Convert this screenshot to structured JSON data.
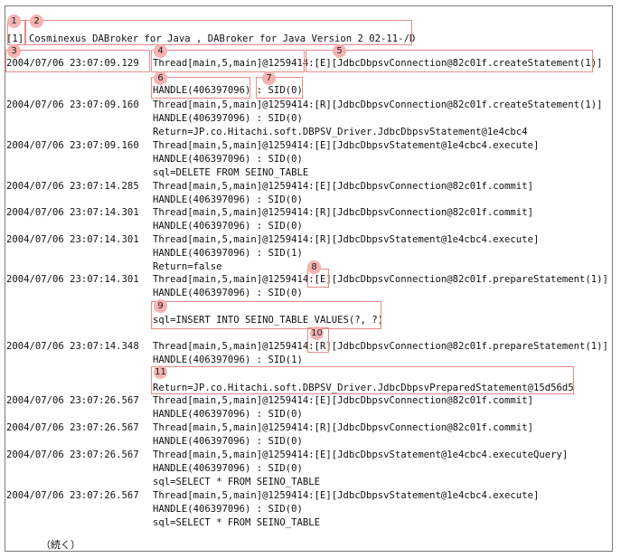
{
  "header": {
    "index": "[1]",
    "title": "Cosminexus DABroker for Java , DABroker for Java Version 2 02-11-/D"
  },
  "badges": [
    "1",
    "2",
    "3",
    "4",
    "5",
    "6",
    "7",
    "8",
    "9",
    "10",
    "11"
  ],
  "entries": [
    {
      "ts": "2004/07/06 23:07:09.129",
      "lines": [
        "Thread[main,5,main]@1259414:[E][JdbcDbpsvConnection@82c01f.createStatement(1)]",
        "HANDLE(406397096) : SID(0)"
      ]
    },
    {
      "ts": "2004/07/06 23:07:09.160",
      "lines": [
        "Thread[main,5,main]@1259414:[R][JdbcDbpsvConnection@82c01f.createStatement(1)]",
        "HANDLE(406397096) : SID(0)",
        "Return=JP.co.Hitachi.soft.DBPSV_Driver.JdbcDbpsvStatement@1e4cbc4"
      ]
    },
    {
      "ts": "2004/07/06 23:07:09.160",
      "lines": [
        "Thread[main,5,main]@1259414:[E][JdbcDbpsvStatement@1e4cbc4.execute]",
        "HANDLE(406397096) : SID(0)",
        "sql=DELETE FROM SEINO_TABLE"
      ]
    },
    {
      "ts": "2004/07/06 23:07:14.285",
      "lines": [
        "Thread[main,5,main]@1259414:[E][JdbcDbpsvConnection@82c01f.commit]",
        "HANDLE(406397096) : SID(0)"
      ]
    },
    {
      "ts": "2004/07/06 23:07:14.301",
      "lines": [
        "Thread[main,5,main]@1259414:[R][JdbcDbpsvConnection@82c01f.commit]",
        "HANDLE(406397096) : SID(0)"
      ]
    },
    {
      "ts": "2004/07/06 23:07:14.301",
      "lines": [
        "Thread[main,5,main]@1259414:[R][JdbcDbpsvStatement@1e4cbc4.execute]",
        "HANDLE(406397096) : SID(1)",
        "Return=false"
      ]
    },
    {
      "ts": "2004/07/06 23:07:14.301",
      "lines": [
        "Thread[main,5,main]@1259414:[E][JdbcDbpsvConnection@82c01f.prepareStatement(1)]",
        "HANDLE(406397096) : SID(0)",
        "sql=INSERT INTO SEINO_TABLE VALUES(?, ?)"
      ]
    },
    {
      "ts": "2004/07/06 23:07:14.348",
      "lines": [
        "Thread[main,5,main]@1259414:[R][JdbcDbpsvConnection@82c01f.prepareStatement(1)]",
        "HANDLE(406397096) : SID(1)",
        "Return=JP.co.Hitachi.soft.DBPSV_Driver.JdbcDbpsvPreparedStatement@15d56d5"
      ]
    },
    {
      "ts": "2004/07/06 23:07:26.567",
      "lines": [
        "Thread[main,5,main]@1259414:[E][JdbcDbpsvConnection@82c01f.commit]",
        "HANDLE(406397096) : SID(0)"
      ]
    },
    {
      "ts": "2004/07/06 23:07:26.567",
      "lines": [
        "Thread[main,5,main]@1259414:[R][JdbcDbpsvConnection@82c01f.commit]",
        "HANDLE(406397096) : SID(0)"
      ]
    },
    {
      "ts": "2004/07/06 23:07:26.567",
      "lines": [
        "Thread[main,5,main]@1259414:[E][JdbcDbpsvStatement@1e4cbc4.executeQuery]",
        "HANDLE(406397096) : SID(0)",
        "sql=SELECT * FROM SEINO_TABLE"
      ]
    },
    {
      "ts": "2004/07/06 23:07:26.567",
      "lines": [
        "Thread[main,5,main]@1259414:[E][JdbcDbpsvStatement@1e4cbc4.execute]",
        "HANDLE(406397096) : SID(0)",
        "sql=SELECT * FROM SEINO_TABLE"
      ]
    }
  ],
  "footer": {
    "continued": "（続く）"
  }
}
